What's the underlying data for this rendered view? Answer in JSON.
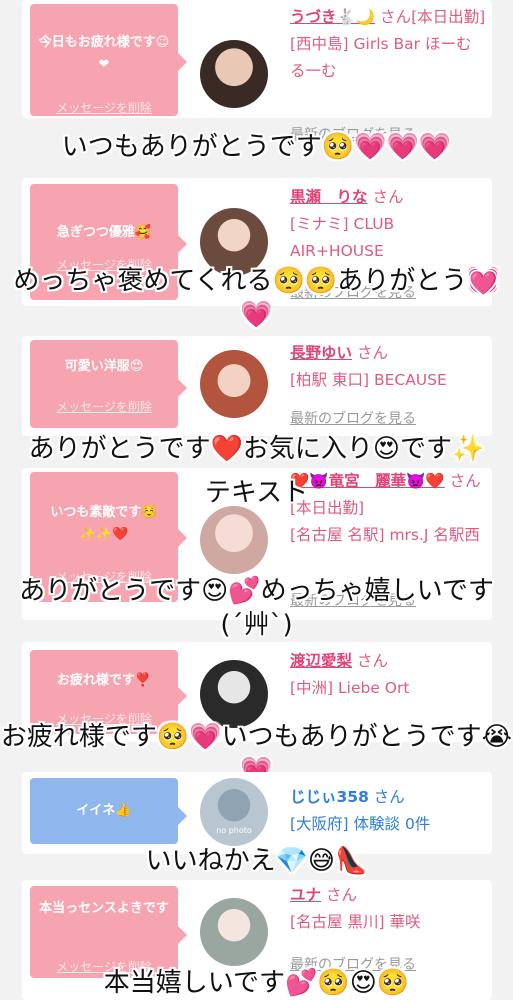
{
  "cards": [
    {
      "message": "今日もお疲れ様です☺❤",
      "delete_label": "メッセージを削除",
      "name": "うづき🐇🌙",
      "san": "さん",
      "status": "[本日出勤]",
      "shop": "[西中島] Girls Bar ほーむる一む",
      "blog": "最新のブログを見る",
      "caption": "いつもありがとうです🥺💗💗💗"
    },
    {
      "message": "急ぎつつ優雅🥰",
      "delete_label": "メッセージを削除",
      "name": "黒瀬　りな",
      "san": "さん",
      "shop": "[ミナミ] CLUB AIR+HOUSE",
      "blog": "最新のブログを見る",
      "caption": "めっちゃ褒めてくれる🥺🥺ありがとう💓💗"
    },
    {
      "message": "可愛い洋服😍",
      "delete_label": "メッセージを削除",
      "name": "長野ゆい",
      "san": "さん",
      "shop": "[柏駅 東口] BECAUSE",
      "blog": "最新のブログを見る",
      "caption": "ありがとうです❤️お気に入り😍です✨"
    },
    {
      "message": "いつも素敵です☺️✨✨❤️",
      "delete_label": "メッセージを削除",
      "name": "❤️👿竜宮　麗華👿❤️",
      "san": "さん",
      "status": "[本日出勤]",
      "shop": "[名古屋 名駅] mrs.J 名駅西",
      "blog": "最新のブログを見る",
      "overlay_text": "テキスト",
      "caption": "ありがとうです😍💕めっちゃ嬉しいです(´艸`)"
    },
    {
      "message": "お疲れ様です❣️",
      "delete_label": "メッセージを削除",
      "name": "渡辺愛梨",
      "san": "さん",
      "shop": "[中洲] Liebe Ort",
      "caption": "お疲れ様です🥺💗いつもありがとうです😭💗"
    },
    {
      "message": "イイネ👍",
      "name": "じじぃ358",
      "san": "さん",
      "shop": "[大阪府] 体験談 0件",
      "avatar_text": "no photo",
      "caption": "いいねかえ💎😅👠"
    },
    {
      "message": "本当っセンスよきです",
      "delete_label": "メッセージを削除",
      "name": "ユナ",
      "san": "さん",
      "shop": "[名古屋 黒川] 華咲",
      "blog": "最新のブログを見る",
      "caption": "本当嬉しいです💕🥺😍🥺"
    }
  ],
  "colors": {
    "bubble_pink": "#f7a4b1",
    "bubble_blue": "#8fb7ee",
    "name_pink": "#e0447a",
    "name_blue": "#2e7fd8"
  }
}
